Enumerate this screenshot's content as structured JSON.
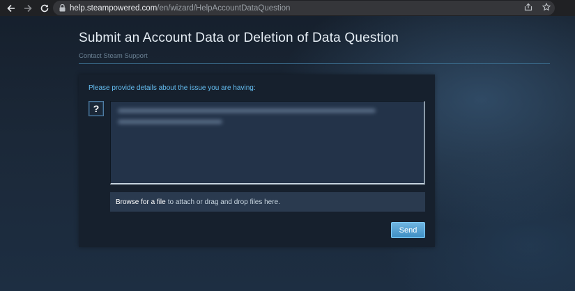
{
  "browser": {
    "url_host": "help.steampowered.com",
    "url_path": "/en/wizard/HelpAccountDataQuestion",
    "icons": [
      "back-icon",
      "forward-icon",
      "reload-icon",
      "lock-icon",
      "share-icon",
      "bookmark-star-icon"
    ]
  },
  "page": {
    "title": "Submit an Account Data or Deletion of Data Question",
    "breadcrumb": "Contact Steam Support"
  },
  "form": {
    "prompt": "Please provide details about the issue you are having:",
    "help_badge": "?",
    "attach": {
      "browse_label": "Browse for a file",
      "rest_label": "to attach or drag and drop files here."
    },
    "send_label": "Send"
  },
  "colors": {
    "background": "#1b2838",
    "accent": "#66c0f4",
    "send_button": "#4a9ad0"
  }
}
